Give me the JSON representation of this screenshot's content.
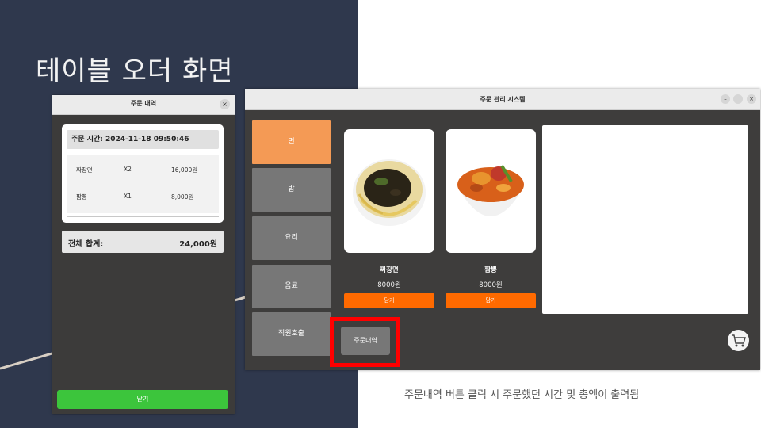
{
  "slide": {
    "title": "테이블 오더 화면",
    "caption": "주문내역 버튼 클릭 시 주문했던 시간 및 총액이 출력됨",
    "colors": {
      "background_left": "#2f384d",
      "background_right": "#ffffff"
    }
  },
  "order_history_dialog": {
    "title": "주문 내역",
    "close_icon": "close-icon",
    "order_time": "주문 시간: 2024-11-18 09:50:46",
    "items": [
      {
        "name": "짜장면",
        "qty": "X2",
        "price": "16,000원"
      },
      {
        "name": "짬뽕",
        "qty": "X1",
        "price": "8,000원"
      }
    ],
    "total_label": "전체 합계:",
    "total_value": "24,000원",
    "close_button": "닫기",
    "colors": {
      "close_button": "#3cc53c"
    }
  },
  "main_window": {
    "title": "주문 관리 시스템",
    "window_controls": [
      "–",
      "□",
      "×"
    ],
    "categories": [
      {
        "label": "면",
        "active": true
      },
      {
        "label": "밥",
        "active": false
      },
      {
        "label": "요리",
        "active": false
      },
      {
        "label": "음료",
        "active": false
      },
      {
        "label": "직원호출",
        "active": false
      }
    ],
    "menu_items": [
      {
        "name": "짜장면",
        "price": "8000원",
        "button": "담기",
        "image": "jajangmyeon-image"
      },
      {
        "name": "짬뽕",
        "price": "8000원",
        "button": "담기",
        "image": "jjamppong-image"
      }
    ],
    "history_button": "주문내역",
    "cart_icon": "cart-icon",
    "colors": {
      "active_category": "#f49a55",
      "add_button": "#ff6a00",
      "highlight": "#ff0000"
    }
  }
}
